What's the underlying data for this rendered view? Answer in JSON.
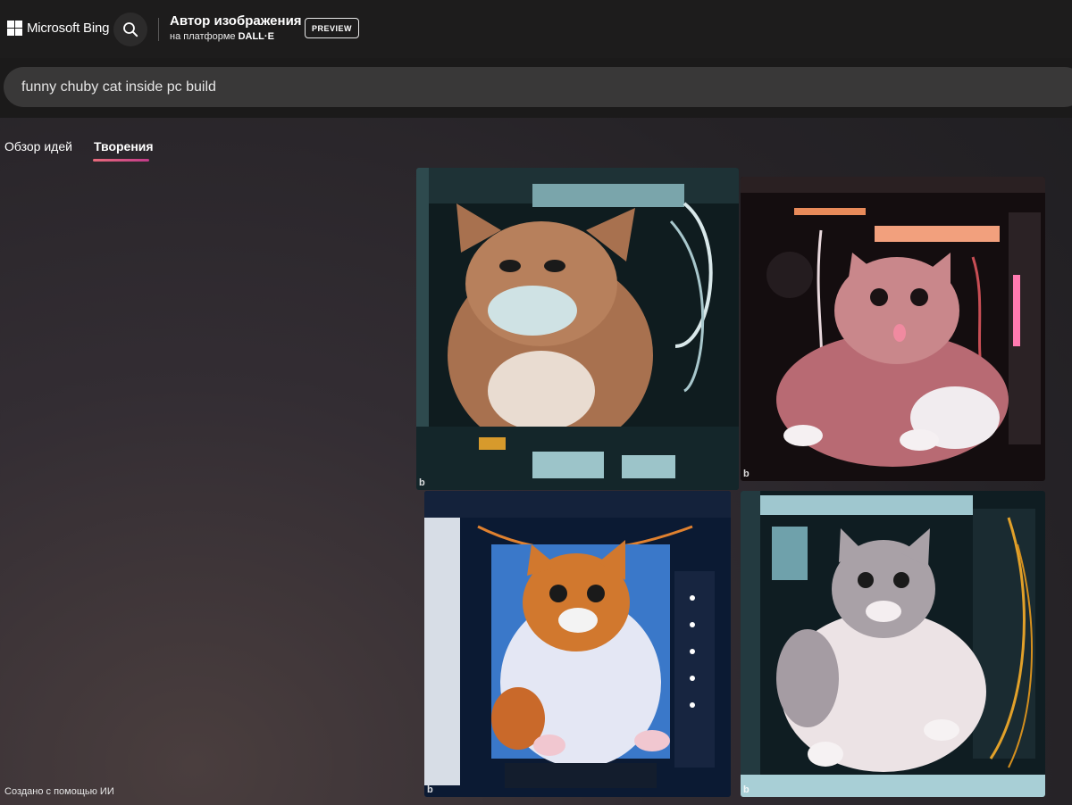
{
  "header": {
    "logo_text": "Microsoft Bing",
    "logo_icon": "microsoft-logo-icon",
    "search_icon": "search-icon",
    "title": "Автор изображения",
    "subtitle_prefix": "на платформе",
    "subtitle_brand": "DALL·E",
    "badge": "PREVIEW"
  },
  "search": {
    "value": "funny chuby cat inside pc build"
  },
  "tabs": [
    {
      "label": "Обзор идей",
      "active": false
    },
    {
      "label": "Творения",
      "active": true
    }
  ],
  "colors": {
    "header_bg": "#1d1c1c",
    "input_bg": "#393838",
    "tab_underline_start": "#e76b7b",
    "tab_underline_end": "#c23b8a"
  },
  "images": [
    {
      "mark": "b"
    },
    {
      "mark": "b"
    },
    {
      "mark": "b"
    },
    {
      "mark": "b"
    }
  ],
  "footer": {
    "note": "Создано с помощью ИИ"
  }
}
